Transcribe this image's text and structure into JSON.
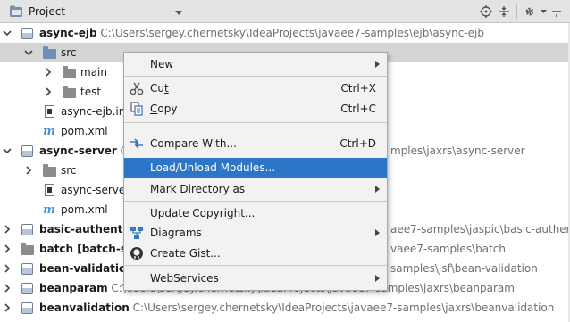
{
  "header": {
    "title": "Project",
    "tool_icons": [
      "locate-icon",
      "collapse-icon",
      "settings-icon",
      "hide-icon"
    ]
  },
  "tree": {
    "rows": [
      {
        "name": "async-ejb",
        "path": "C:\\Users\\sergey.chernetsky\\IdeaProjects\\javaee7-samples\\ejb\\async-ejb"
      },
      {
        "name": "src"
      },
      {
        "name": "main"
      },
      {
        "name": "test"
      },
      {
        "name": "async-ejb.im"
      },
      {
        "name": "pom.xml"
      },
      {
        "name": "async-server",
        "path": "C",
        "path_right": "mples\\jaxrs\\async-server"
      },
      {
        "name": "src"
      },
      {
        "name": "async-server"
      },
      {
        "name": "pom.xml"
      },
      {
        "name": "basic-authentic",
        "path_right": "aee7-samples\\jaspic\\basic-authenti"
      },
      {
        "name": "batch [batch-sa",
        "path_right": "vaee7-samples\\batch"
      },
      {
        "name": "bean-validation",
        "path_right": "samples\\jsf\\bean-validation"
      },
      {
        "name": "beanparam",
        "path": "C:\\Users\\sergey.chernetsky\\IdeaProjects\\javaee7-samples\\jaxrs\\beanparam"
      },
      {
        "name": "beanvalidation",
        "path": "C:\\Users\\sergey.chernetsky\\IdeaProjects\\javaee7-samples\\jaxrs\\beanvalidation"
      }
    ]
  },
  "menu": {
    "items": [
      {
        "label": "New",
        "submenu": true
      },
      {
        "label_pre": "Cu",
        "label_u": "t",
        "label_post": "",
        "shortcut": "Ctrl+X",
        "icon": "scissors-icon"
      },
      {
        "label_pre": "",
        "label_u": "C",
        "label_post": "opy",
        "shortcut": "Ctrl+C",
        "icon": "copy-icon"
      },
      {
        "label": "Compare With...",
        "shortcut": "Ctrl+D",
        "icon": "compare-icon"
      },
      {
        "label": "Load/Unload Modules...",
        "highlighted": true
      },
      {
        "label": "Mark Directory as",
        "submenu": true
      },
      {
        "label": "Update Copyright..."
      },
      {
        "label": "Diagrams",
        "submenu": true,
        "icon": "diagram-icon"
      },
      {
        "label": "Create Gist...",
        "icon": "github-icon"
      },
      {
        "label": "WebServices",
        "submenu": true
      }
    ]
  },
  "colors": {
    "highlight": "#2d76c7",
    "selected_row": "#d5d5d5",
    "header_bg": "#e4e4e4",
    "menu_bg": "#f2f2f2"
  }
}
